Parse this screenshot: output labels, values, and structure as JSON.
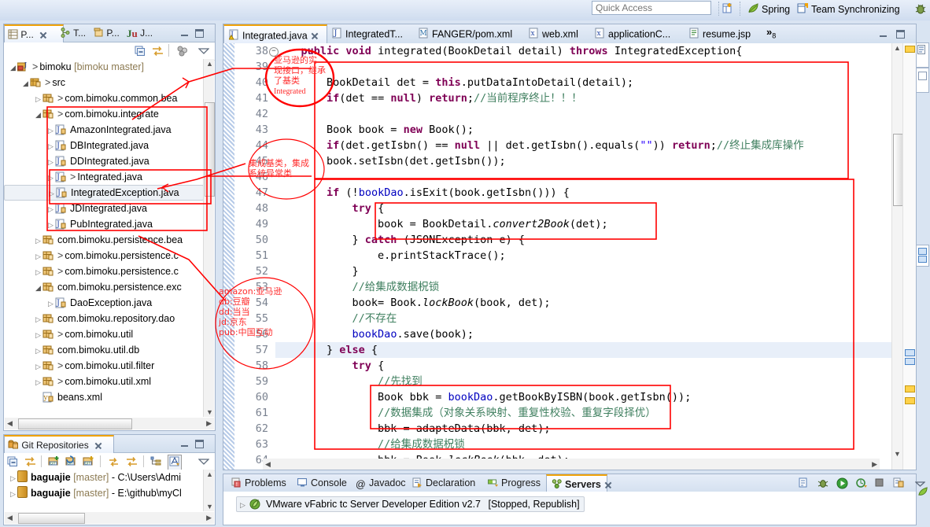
{
  "toolbar": {
    "quick_access_placeholder": "Quick Access",
    "perspective_new_icon": "new-perspective-icon",
    "items": [
      {
        "label": "Spring",
        "icon": "spring-leaf-icon"
      },
      {
        "label": "Team Synchronizing",
        "icon": "team-sync-icon"
      }
    ],
    "debug_icon": "debug-bug-icon"
  },
  "package_explorer": {
    "tabs": [
      {
        "label": "P...",
        "icon": "package-explorer-icon",
        "active": true
      },
      {
        "label": "T...",
        "icon": "type-hierarchy-icon",
        "active": false
      },
      {
        "label": "P...",
        "icon": "project-explorer-icon",
        "active": false
      },
      {
        "label": "J...",
        "icon": "junit-icon",
        "active": false
      }
    ],
    "toolbar_icons": [
      "collapse-all-icon",
      "link-with-editor-icon",
      "view-menu-icon",
      "view-dropdown-icon"
    ],
    "tree": [
      {
        "indent": 0,
        "arrow": "open",
        "icon": "java-project-icon",
        "gt": ">",
        "label": "bimoku",
        "suffix": "[bimoku master]",
        "selected": false
      },
      {
        "indent": 1,
        "arrow": "open",
        "icon": "source-folder-icon",
        "gt": ">",
        "label": "src",
        "suffix": "",
        "selected": false
      },
      {
        "indent": 2,
        "arrow": "closed",
        "icon": "package-icon",
        "gt": ">",
        "label": "com.bimoku.common.bea",
        "suffix": "",
        "selected": false
      },
      {
        "indent": 2,
        "arrow": "open",
        "icon": "package-icon",
        "gt": ">",
        "label": "com.bimoku.integrate",
        "suffix": "",
        "selected": false
      },
      {
        "indent": 3,
        "arrow": "closed",
        "icon": "java-class-icon",
        "gt": "",
        "label": "AmazonIntegrated.java",
        "suffix": "",
        "selected": false
      },
      {
        "indent": 3,
        "arrow": "closed",
        "icon": "java-class-icon",
        "gt": "",
        "label": "DBIntegrated.java",
        "suffix": "",
        "selected": false
      },
      {
        "indent": 3,
        "arrow": "closed",
        "icon": "java-class-icon",
        "gt": "",
        "label": "DDIntegrated.java",
        "suffix": "",
        "selected": false
      },
      {
        "indent": 3,
        "arrow": "closed",
        "icon": "java-class-icon",
        "gt": ">",
        "label": "Integrated.java",
        "suffix": "",
        "selected": false
      },
      {
        "indent": 3,
        "arrow": "closed",
        "icon": "java-class-icon",
        "gt": "",
        "label": "IntegratedException.java",
        "suffix": "",
        "selected": true
      },
      {
        "indent": 3,
        "arrow": "closed",
        "icon": "java-class-icon",
        "gt": "",
        "label": "JDIntegrated.java",
        "suffix": "",
        "selected": false
      },
      {
        "indent": 3,
        "arrow": "closed",
        "icon": "java-class-icon",
        "gt": "",
        "label": "PubIntegrated.java",
        "suffix": "",
        "selected": false
      },
      {
        "indent": 2,
        "arrow": "closed",
        "icon": "package-icon",
        "gt": "",
        "label": "com.bimoku.persistence.bea",
        "suffix": "",
        "selected": false
      },
      {
        "indent": 2,
        "arrow": "closed",
        "icon": "package-icon",
        "gt": ">",
        "label": "com.bimoku.persistence.c",
        "suffix": "",
        "selected": false
      },
      {
        "indent": 2,
        "arrow": "closed",
        "icon": "package-icon",
        "gt": ">",
        "label": "com.bimoku.persistence.c",
        "suffix": "",
        "selected": false
      },
      {
        "indent": 2,
        "arrow": "open",
        "icon": "package-icon",
        "gt": "",
        "label": "com.bimoku.persistence.exc",
        "suffix": "",
        "selected": false
      },
      {
        "indent": 3,
        "arrow": "closed",
        "icon": "java-class-icon",
        "gt": "",
        "label": "DaoException.java",
        "suffix": "",
        "selected": false
      },
      {
        "indent": 2,
        "arrow": "closed",
        "icon": "package-icon",
        "gt": "",
        "label": "com.bimoku.repository.dao",
        "suffix": "",
        "selected": false
      },
      {
        "indent": 2,
        "arrow": "closed",
        "icon": "package-icon",
        "gt": ">",
        "label": "com.bimoku.util",
        "suffix": "",
        "selected": false
      },
      {
        "indent": 2,
        "arrow": "closed",
        "icon": "package-icon",
        "gt": "",
        "label": "com.bimoku.util.db",
        "suffix": "",
        "selected": false
      },
      {
        "indent": 2,
        "arrow": "closed",
        "icon": "package-icon",
        "gt": ">",
        "label": "com.bimoku.util.filter",
        "suffix": "",
        "selected": false
      },
      {
        "indent": 2,
        "arrow": "closed",
        "icon": "package-icon",
        "gt": ">",
        "label": "com.bimoku.util.xml",
        "suffix": "",
        "selected": false
      },
      {
        "indent": 2,
        "arrow": "none",
        "icon": "xml-file-icon",
        "gt": "",
        "label": "beans.xml",
        "suffix": "",
        "selected": false
      }
    ]
  },
  "git_repositories": {
    "tab_label": "Git Repositories",
    "tab_icon": "git-repo-icon",
    "toolbar_icons": [
      "collapse-all-icon",
      "link-editor-icon",
      "add-repo-icon",
      "clone-repo-icon",
      "create-repo-icon",
      "refresh-icon",
      "link-selection-icon",
      "hierarchy-icon",
      "toggle-branch-icon",
      "view-menu-icon"
    ],
    "rows": [
      {
        "name": "baguajie",
        "branch": "[master]",
        "path": "- C:\\Users\\Admi"
      },
      {
        "name": "baguajie",
        "branch": "[master]",
        "path": "- E:\\github\\myCl"
      }
    ]
  },
  "editor": {
    "tabs": [
      {
        "label": "Integrated.java",
        "icon": "java-warning-icon",
        "active": true,
        "closable": true
      },
      {
        "label": "IntegratedT...",
        "icon": "java-icon",
        "active": false,
        "closable": false
      },
      {
        "label": "FANGER/pom.xml",
        "icon": "maven-icon",
        "active": false,
        "closable": false
      },
      {
        "label": "web.xml",
        "icon": "xml-icon",
        "active": false,
        "closable": false
      },
      {
        "label": "applicationC...",
        "icon": "xml-icon",
        "active": false,
        "closable": false
      },
      {
        "label": "resume.jsp",
        "icon": "jsp-icon",
        "active": false,
        "closable": false
      }
    ],
    "more_tabs_indicator": "»",
    "more_tabs_count": "8",
    "first_line": 38,
    "highlight_line": 57,
    "fold_lines": [
      38
    ],
    "lines": [
      {
        "n": 38,
        "tokens": [
          {
            "t": "    ",
            "c": "pln"
          },
          {
            "t": "public void ",
            "c": "kw"
          },
          {
            "t": "integrated(BookDetail detail) ",
            "c": "pln"
          },
          {
            "t": "throws ",
            "c": "kw"
          },
          {
            "t": "IntegratedException{",
            "c": "pln"
          }
        ]
      },
      {
        "n": 39,
        "tokens": [
          {
            "t": "",
            "c": "pln"
          }
        ]
      },
      {
        "n": 40,
        "tokens": [
          {
            "t": "        BookDetail det = ",
            "c": "pln"
          },
          {
            "t": "this",
            "c": "kw"
          },
          {
            "t": ".putDataIntoDetail(detail);",
            "c": "pln"
          }
        ]
      },
      {
        "n": 41,
        "tokens": [
          {
            "t": "        ",
            "c": "pln"
          },
          {
            "t": "if",
            "c": "kw"
          },
          {
            "t": "(det == ",
            "c": "pln"
          },
          {
            "t": "null",
            "c": "kw"
          },
          {
            "t": ") ",
            "c": "pln"
          },
          {
            "t": "return",
            "c": "kw"
          },
          {
            "t": ";",
            "c": "pln"
          },
          {
            "t": "//当前程序终止！！！",
            "c": "cm"
          }
        ]
      },
      {
        "n": 42,
        "tokens": [
          {
            "t": "",
            "c": "pln"
          }
        ]
      },
      {
        "n": 43,
        "tokens": [
          {
            "t": "        Book book = ",
            "c": "pln"
          },
          {
            "t": "new ",
            "c": "kw"
          },
          {
            "t": "Book();",
            "c": "pln"
          }
        ]
      },
      {
        "n": 44,
        "tokens": [
          {
            "t": "        ",
            "c": "pln"
          },
          {
            "t": "if",
            "c": "kw"
          },
          {
            "t": "(det.getIsbn() == ",
            "c": "pln"
          },
          {
            "t": "null ",
            "c": "kw"
          },
          {
            "t": "|| det.getIsbn().equals(",
            "c": "pln"
          },
          {
            "t": "\"\"",
            "c": "st"
          },
          {
            "t": ")) ",
            "c": "pln"
          },
          {
            "t": "return",
            "c": "kw"
          },
          {
            "t": ";",
            "c": "pln"
          },
          {
            "t": "//终止集成库操作",
            "c": "cm"
          }
        ]
      },
      {
        "n": 45,
        "tokens": [
          {
            "t": "        book.setIsbn(det.getIsbn());",
            "c": "pln"
          }
        ]
      },
      {
        "n": 46,
        "tokens": [
          {
            "t": "",
            "c": "pln"
          }
        ]
      },
      {
        "n": 47,
        "tokens": [
          {
            "t": "        ",
            "c": "pln"
          },
          {
            "t": "if ",
            "c": "kw"
          },
          {
            "t": "(!",
            "c": "pln"
          },
          {
            "t": "bookDao",
            "c": "fld"
          },
          {
            "t": ".isExit(book.getIsbn())) {",
            "c": "pln"
          }
        ]
      },
      {
        "n": 48,
        "tokens": [
          {
            "t": "            ",
            "c": "pln"
          },
          {
            "t": "try ",
            "c": "kw"
          },
          {
            "t": "{",
            "c": "pln"
          }
        ]
      },
      {
        "n": 49,
        "tokens": [
          {
            "t": "                book = BookDetail.",
            "c": "pln"
          },
          {
            "t": "convert2Book",
            "c": "mth"
          },
          {
            "t": "(det);",
            "c": "pln"
          }
        ]
      },
      {
        "n": 50,
        "tokens": [
          {
            "t": "            } ",
            "c": "pln"
          },
          {
            "t": "catch ",
            "c": "kw"
          },
          {
            "t": "(JSONException e) {",
            "c": "pln"
          }
        ]
      },
      {
        "n": 51,
        "tokens": [
          {
            "t": "                e.printStackTrace();",
            "c": "pln"
          }
        ]
      },
      {
        "n": 52,
        "tokens": [
          {
            "t": "            }",
            "c": "pln"
          }
        ]
      },
      {
        "n": 53,
        "tokens": [
          {
            "t": "            ",
            "c": "pln"
          },
          {
            "t": "//给集成数据柷锁",
            "c": "cm"
          }
        ]
      },
      {
        "n": 54,
        "tokens": [
          {
            "t": "            book= Book.",
            "c": "pln"
          },
          {
            "t": "lockBook",
            "c": "mth"
          },
          {
            "t": "(book, det);",
            "c": "pln"
          }
        ]
      },
      {
        "n": 55,
        "tokens": [
          {
            "t": "            ",
            "c": "pln"
          },
          {
            "t": "//不存在",
            "c": "cm"
          }
        ]
      },
      {
        "n": 56,
        "tokens": [
          {
            "t": "            ",
            "c": "pln"
          },
          {
            "t": "bookDao",
            "c": "fld"
          },
          {
            "t": ".save(book);",
            "c": "pln"
          }
        ]
      },
      {
        "n": 57,
        "tokens": [
          {
            "t": "        } ",
            "c": "pln"
          },
          {
            "t": "else ",
            "c": "kw"
          },
          {
            "t": "{",
            "c": "pln"
          }
        ]
      },
      {
        "n": 58,
        "tokens": [
          {
            "t": "            ",
            "c": "pln"
          },
          {
            "t": "try ",
            "c": "kw"
          },
          {
            "t": "{",
            "c": "pln"
          }
        ]
      },
      {
        "n": 59,
        "tokens": [
          {
            "t": "                ",
            "c": "pln"
          },
          {
            "t": "//先找到",
            "c": "cm"
          }
        ]
      },
      {
        "n": 60,
        "tokens": [
          {
            "t": "                Book bbk = ",
            "c": "pln"
          },
          {
            "t": "bookDao",
            "c": "fld"
          },
          {
            "t": ".getBookByISBN(book.getIsbn());",
            "c": "pln"
          }
        ]
      },
      {
        "n": 61,
        "tokens": [
          {
            "t": "                ",
            "c": "pln"
          },
          {
            "t": "//数据集成（对象关系映射、重复性校验、重复字段择优）",
            "c": "cm"
          }
        ]
      },
      {
        "n": 62,
        "tokens": [
          {
            "t": "                bbk = adapteData(bbk, det);",
            "c": "pln"
          }
        ]
      },
      {
        "n": 63,
        "tokens": [
          {
            "t": "                ",
            "c": "pln"
          },
          {
            "t": "//给集成数据柷锁",
            "c": "cm"
          }
        ]
      },
      {
        "n": 64,
        "tokens": [
          {
            "t": "                bbk = Book.",
            "c": "pln"
          },
          {
            "t": "lockBook",
            "c": "mth"
          },
          {
            "t": "(bbk, det);",
            "c": "pln"
          }
        ]
      }
    ]
  },
  "bottom_panel": {
    "tabs": [
      {
        "label": "Problems",
        "icon": "problems-icon",
        "active": false
      },
      {
        "label": "Console",
        "icon": "console-icon",
        "active": false
      },
      {
        "label": "Javadoc",
        "icon": "javadoc-icon",
        "active": false
      },
      {
        "label": "Declaration",
        "icon": "declaration-icon",
        "active": false
      },
      {
        "label": "Progress",
        "icon": "progress-icon",
        "active": false
      },
      {
        "label": "Servers",
        "icon": "servers-icon",
        "active": true
      }
    ],
    "toolbar_icons": [
      "new-server-icon",
      "debug-server-icon",
      "start-server-icon",
      "profile-server-icon",
      "stop-server-icon",
      "publish-icon",
      "view-menu-icon"
    ],
    "server": {
      "name": "VMware vFabric tc Server Developer Edition v2.7",
      "status": "[Stopped, Republish]",
      "icon": "tc-server-icon"
    }
  },
  "annotations": {
    "note1": "亚马逊的实\n现接口，继承\n了基类",
    "note1b": "Integrated",
    "note2": "集成基类，集成\n系统异常类",
    "legend": "amazon:亚马逊\ndb:豆瓣\ndd:当当\njd:京东\npub:中国互动",
    "color": "#ff2d2d"
  }
}
